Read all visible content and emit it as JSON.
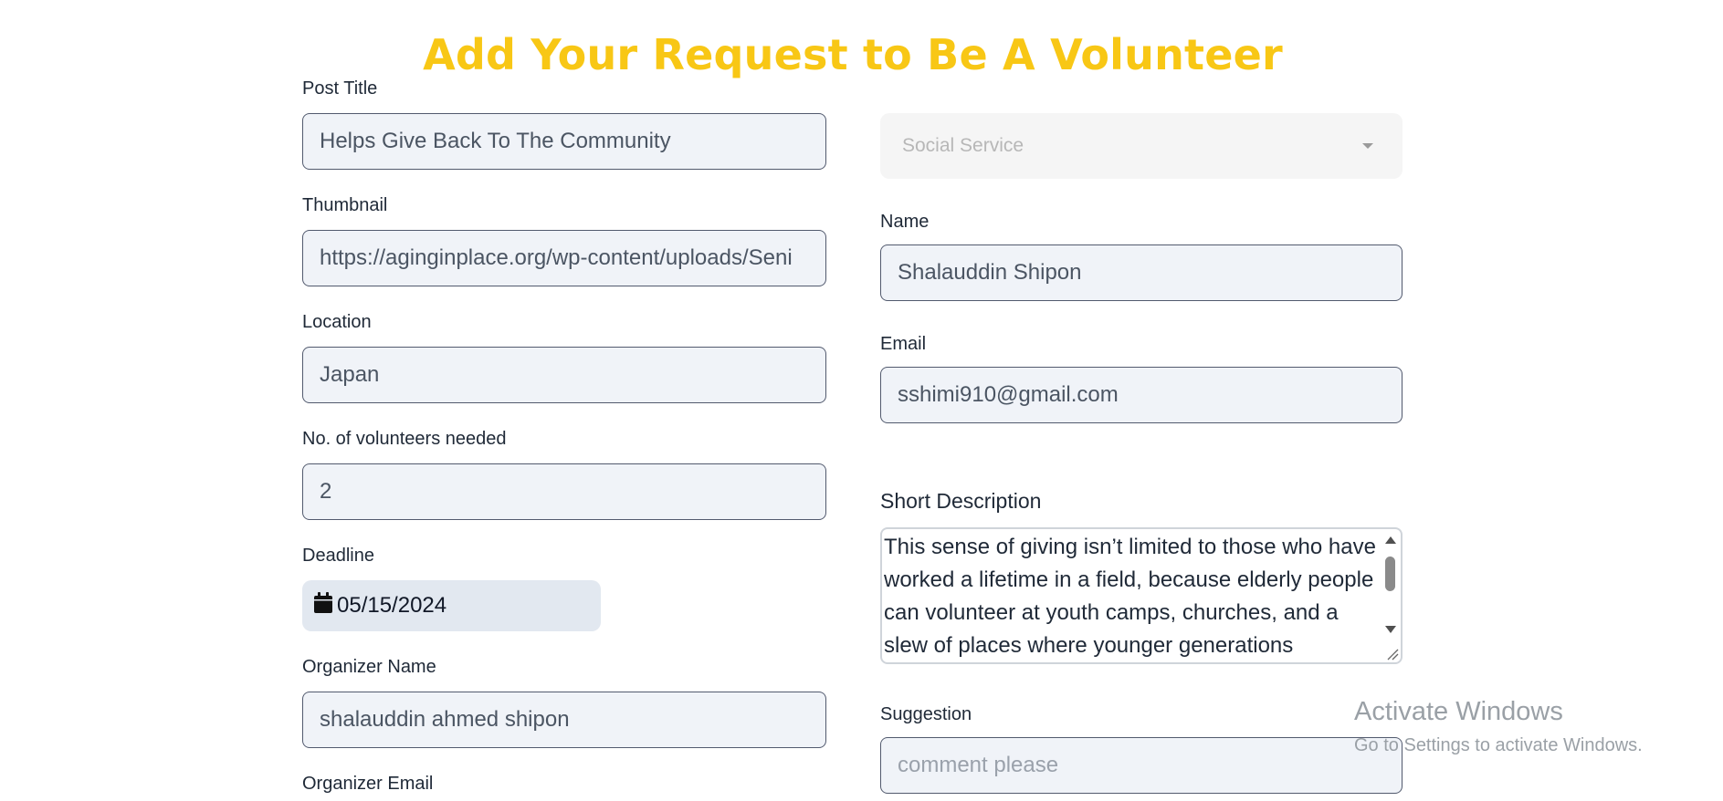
{
  "page": {
    "title": "Add Your Request to Be A Volunteer"
  },
  "form": {
    "post_title": {
      "label": "Post Title",
      "value": "Helps Give Back To The Community"
    },
    "thumbnail": {
      "label": "Thumbnail",
      "value": "https://aginginplace.org/wp-content/uploads/Seni"
    },
    "location": {
      "label": "Location",
      "value": "Japan"
    },
    "volunteers_needed": {
      "label": "No. of volunteers needed",
      "value": "2"
    },
    "deadline": {
      "label": "Deadline",
      "value": "05/15/2024",
      "icon": "calendar-icon"
    },
    "organizer_name": {
      "label": "Organizer Name",
      "value": "shalauddin ahmed shipon"
    },
    "organizer_email": {
      "label": "Organizer Email"
    },
    "category": {
      "selected": "Social Service",
      "icon": "chevron-down-icon"
    },
    "name": {
      "label": "Name",
      "value": "Shalauddin Shipon"
    },
    "email": {
      "label": "Email",
      "value": "sshimi910@gmail.com"
    },
    "short_description": {
      "label": "Short Description",
      "value": "This sense of giving isn’t limited to those who have worked a lifetime in a field, because elderly people can volunteer at youth camps, churches, and a slew of places where younger generations"
    },
    "suggestion": {
      "label": "Suggestion",
      "placeholder": "comment please"
    }
  },
  "watermark": {
    "title": "Activate Windows",
    "subtitle": "Go to Settings to activate Windows."
  },
  "colors": {
    "title": "#f8c715",
    "input_background": "#f0f3f8",
    "input_border": "#525a6e"
  }
}
